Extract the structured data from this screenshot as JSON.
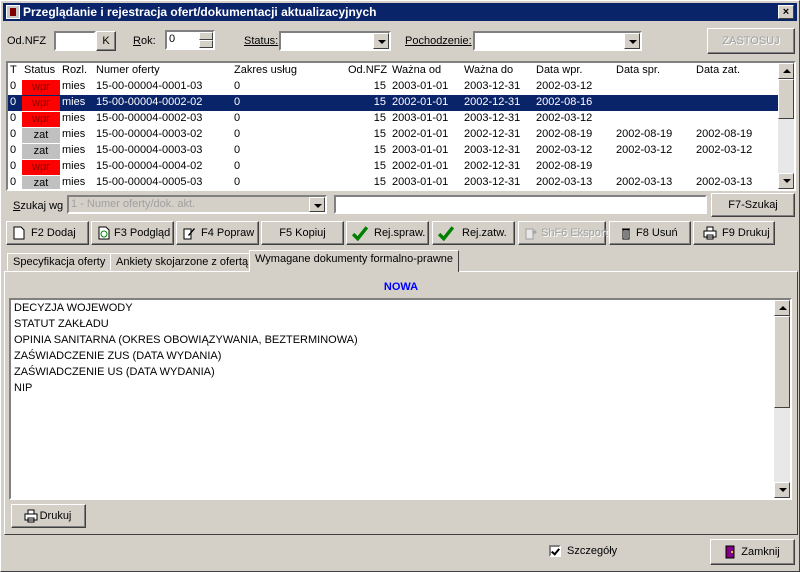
{
  "window": {
    "title": "Przeglądanie i rejestracja ofert/dokumentacji aktualizacyjnych",
    "close": "×"
  },
  "filters": {
    "odnfz_label": "Od.NFZ",
    "odnfz_btn": "K",
    "rok_label": "Rok:",
    "rok_value": "0",
    "status_label": "Status:",
    "status_value": "",
    "pochodzenie_label": "Pochodzenie:",
    "pochodzenie_value": "",
    "apply_label": "ZASTOSUJ"
  },
  "grid": {
    "columns": [
      "T",
      "Status",
      "Rozl.",
      "Numer oferty",
      "Zakres usług",
      "Od.NFZ",
      "Ważna od",
      "Ważna do",
      "Data wpr.",
      "Data spr.",
      "Data zat."
    ],
    "rows": [
      {
        "t": "0",
        "status": "wpr",
        "rozl": "mies",
        "numer": "15-00-00004-0001-03",
        "zakres": "0",
        "odnfz": "15",
        "od": "2003-01-01",
        "do": "2003-12-31",
        "wpr": "2002-03-12",
        "spr": "",
        "zat": "",
        "color": "red",
        "selected": false
      },
      {
        "t": "0",
        "status": "wpr",
        "rozl": "mies",
        "numer": "15-00-00004-0002-02",
        "zakres": "0",
        "odnfz": "15",
        "od": "2002-01-01",
        "do": "2002-12-31",
        "wpr": "2002-08-16",
        "spr": "",
        "zat": "",
        "color": "red",
        "selected": true
      },
      {
        "t": "0",
        "status": "wpr",
        "rozl": "mies",
        "numer": "15-00-00004-0002-03",
        "zakres": "0",
        "odnfz": "15",
        "od": "2003-01-01",
        "do": "2003-12-31",
        "wpr": "2002-03-12",
        "spr": "",
        "zat": "",
        "color": "red",
        "selected": false
      },
      {
        "t": "0",
        "status": "zat",
        "rozl": "mies",
        "numer": "15-00-00004-0003-02",
        "zakres": "0",
        "odnfz": "15",
        "od": "2002-01-01",
        "do": "2002-12-31",
        "wpr": "2002-08-19",
        "spr": "2002-08-19",
        "zat": "2002-08-19",
        "color": "grey",
        "selected": false
      },
      {
        "t": "0",
        "status": "zat",
        "rozl": "mies",
        "numer": "15-00-00004-0003-03",
        "zakres": "0",
        "odnfz": "15",
        "od": "2003-01-01",
        "do": "2003-12-31",
        "wpr": "2002-03-12",
        "spr": "2002-03-12",
        "zat": "2002-03-12",
        "color": "grey",
        "selected": false
      },
      {
        "t": "0",
        "status": "wpr",
        "rozl": "mies",
        "numer": "15-00-00004-0004-02",
        "zakres": "0",
        "odnfz": "15",
        "od": "2002-01-01",
        "do": "2002-12-31",
        "wpr": "2002-08-19",
        "spr": "",
        "zat": "",
        "color": "red",
        "selected": false
      },
      {
        "t": "0",
        "status": "zat",
        "rozl": "mies",
        "numer": "15-00-00004-0005-03",
        "zakres": "0",
        "odnfz": "15",
        "od": "2003-01-01",
        "do": "2003-12-31",
        "wpr": "2002-03-13",
        "spr": "2002-03-13",
        "zat": "2002-03-13",
        "color": "grey",
        "selected": false
      }
    ]
  },
  "search": {
    "label": "Szukaj wg",
    "mode_value": "1 - Numer oferty/dok. akt.",
    "text_value": "",
    "button": "F7-Szukaj"
  },
  "toolbar": {
    "f2": "F2 Dodaj",
    "f3": "F3 Podgląd",
    "f4": "F4 Popraw",
    "f5": "F5 Kopiuj",
    "rejspraw": "Rej.spraw.",
    "rejzatw": "Rej.zatw.",
    "eksport": "ShF6 Eksport",
    "f8": "F8 Usuń",
    "f9": "F9 Drukuj"
  },
  "tabs": [
    "Specyfikacja oferty",
    "Ankiety skojarzone z ofertą",
    "Wymagane dokumenty formalno-prawne"
  ],
  "doc_panel": {
    "status": "NOWA",
    "status_color": "#0000ff",
    "lines": [
      "DECYZJA WOJEWODY",
      "STATUT ZAKŁADU",
      "OPINIA SANITARNA (OKRES OBOWIĄZYWANIA, BEZTERMINOWA)",
      "ZAŚWIADCZENIE ZUS  (DATA WYDANIA)",
      "ZAŚWIADCZENIE US  (DATA WYDANIA)",
      "NIP"
    ],
    "print_label": "Drukuj"
  },
  "footer": {
    "details_label": "Szczegóły",
    "details_checked": true,
    "close_label": "Zamknij"
  },
  "colors": {
    "title_bar": "#0a246a",
    "status_red": "#ff0000",
    "status_grey": "#c0c0c0",
    "selection": "#0a246a"
  }
}
